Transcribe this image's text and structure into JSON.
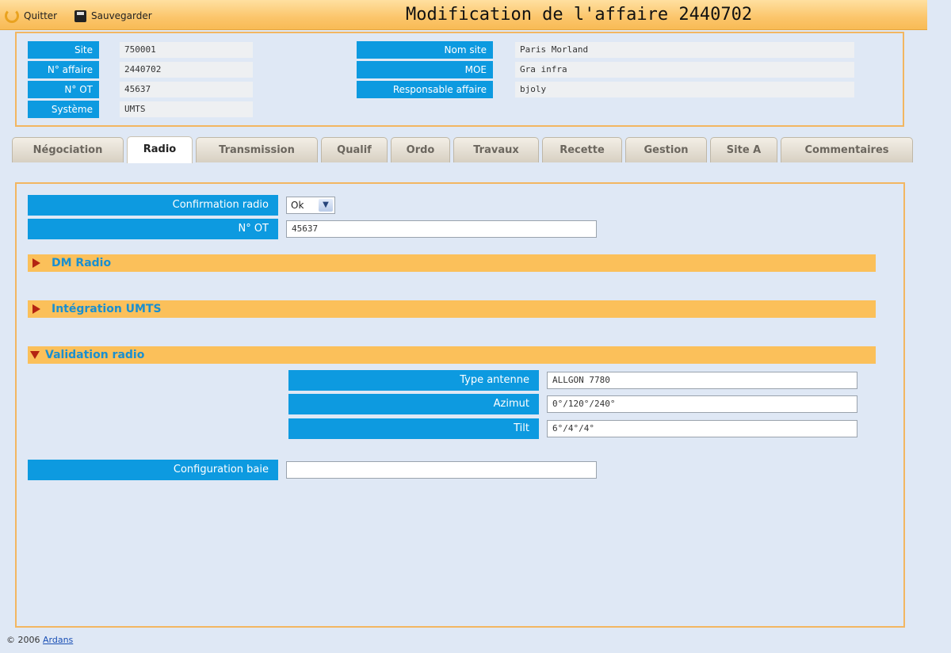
{
  "toolbar": {
    "quit_label": "Quitter",
    "save_label": "Sauvegarder",
    "title": "Modification de l'affaire 2440702"
  },
  "info": {
    "site_label": "Site",
    "site_value": "750001",
    "affaire_label": "N° affaire",
    "affaire_value": "2440702",
    "ot_label": "N° OT",
    "ot_value": "45637",
    "systeme_label": "Système",
    "systeme_value": "UMTS",
    "nom_site_label": "Nom site",
    "nom_site_value": "Paris Morland",
    "moe_label": "MOE",
    "moe_value": "Gra infra",
    "responsable_label": "Responsable affaire",
    "responsable_value": "bjoly"
  },
  "tabs": [
    {
      "label": "Négociation"
    },
    {
      "label": "Radio",
      "active": true
    },
    {
      "label": "Transmission"
    },
    {
      "label": "Qualif"
    },
    {
      "label": "Ordo"
    },
    {
      "label": "Travaux"
    },
    {
      "label": "Recette"
    },
    {
      "label": "Gestion"
    },
    {
      "label": "Site A"
    },
    {
      "label": "Commentaires"
    }
  ],
  "radio": {
    "confirmation_label": "Confirmation radio",
    "confirmation_value": "Ok",
    "ot_label": "N° OT",
    "ot_value": "45637",
    "sections": {
      "dm_radio": "DM Radio",
      "integration": "Intégration UMTS",
      "validation": "Validation radio"
    },
    "validation": {
      "type_antenne_label": "Type antenne",
      "type_antenne_value": "ALLGON 7780",
      "azimut_label": "Azimut",
      "azimut_value": "0°/120°/240°",
      "tilt_label": "Tilt",
      "tilt_value": "6°/4°/4°"
    },
    "config_baie_label": "Configuration baie",
    "config_baie_value": ""
  },
  "footer": {
    "copyright": "© 2006",
    "link": "Ardans"
  },
  "colors": {
    "label_blue": "#0d9ae0",
    "accent_orange": "#fbc05a",
    "page_bg": "#dfe8f5"
  }
}
